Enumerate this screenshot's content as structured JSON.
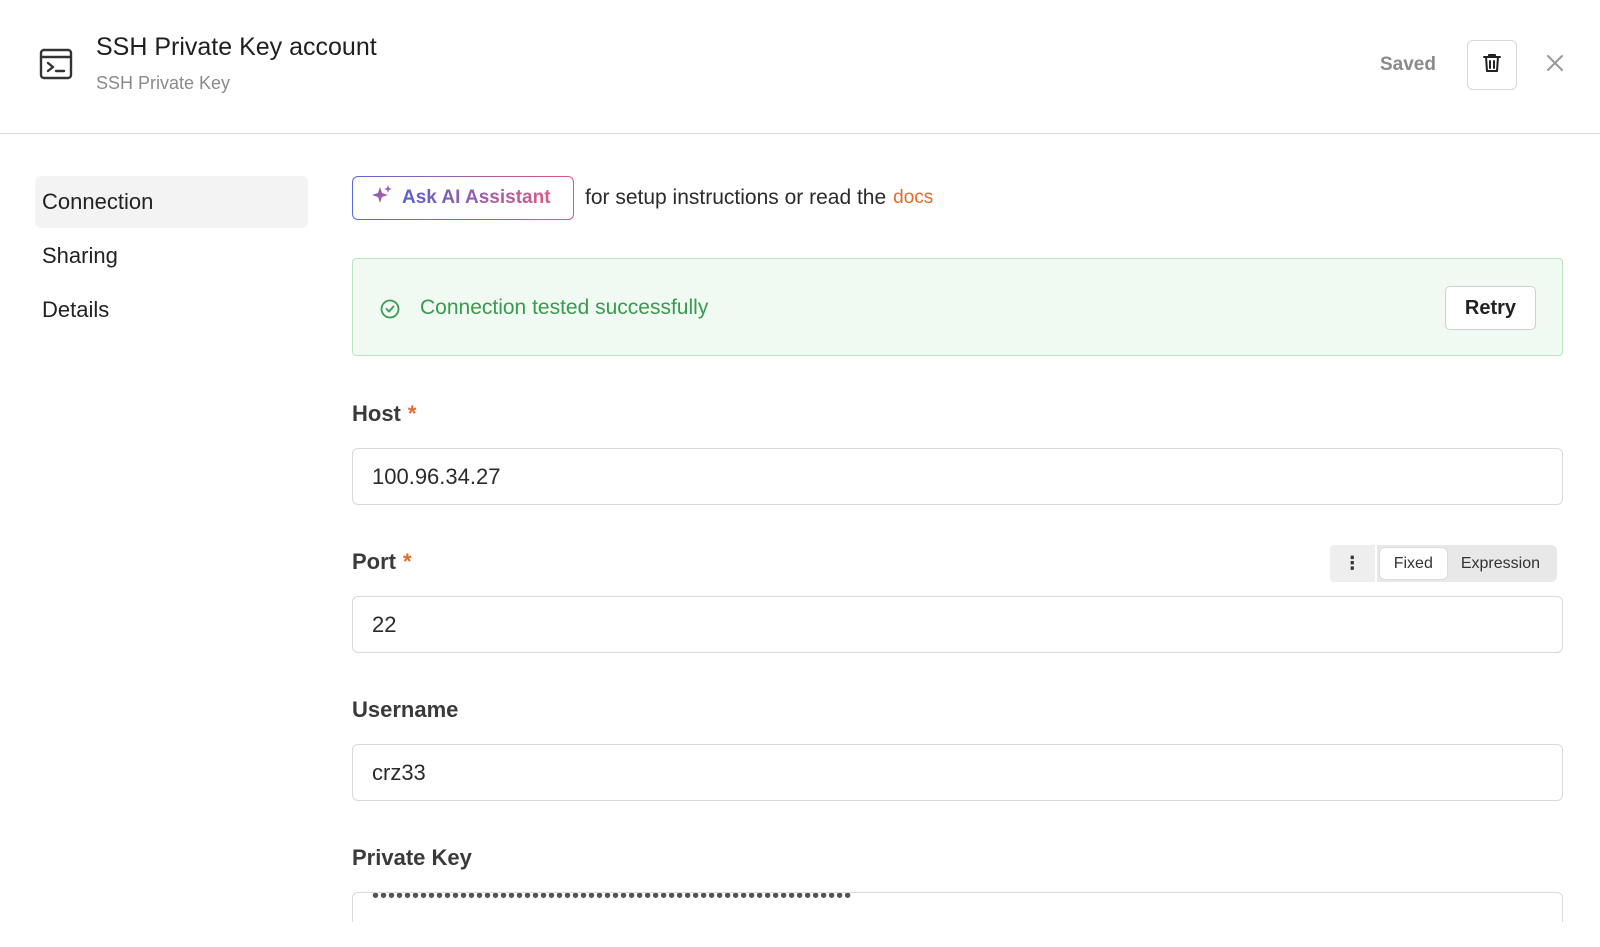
{
  "header": {
    "title": "SSH Private Key account",
    "subtitle": "SSH Private Key",
    "status": "Saved",
    "app_icon": "terminal-icon",
    "delete_icon": "trash-icon",
    "close_icon": "close-icon"
  },
  "sidebar": {
    "items": [
      {
        "label": "Connection",
        "active": true
      },
      {
        "label": "Sharing",
        "active": false
      },
      {
        "label": "Details",
        "active": false
      }
    ]
  },
  "assistant": {
    "button_label": "Ask AI Assistant",
    "text": "for setup instructions or read the",
    "docs_link": "docs",
    "icon": "sparkle-icon"
  },
  "status_banner": {
    "message": "Connection tested successfully",
    "retry_label": "Retry",
    "icon": "check-circle-icon"
  },
  "fields": {
    "host": {
      "label": "Host",
      "required_mark": "*",
      "value": "100.96.34.27"
    },
    "port": {
      "label": "Port",
      "required_mark": "*",
      "value": "22"
    },
    "username": {
      "label": "Username",
      "value": "crz33"
    },
    "private_key": {
      "label": "Private Key",
      "value": "••••••••••••••••••••••••••••••••••••••••••••••••••••••••••••"
    }
  },
  "port_mode": {
    "options": [
      "Fixed",
      "Expression"
    ],
    "selected": "Fixed",
    "menu_icon": "more-vertical-icon"
  },
  "colors": {
    "accent_orange": "#e46b2c",
    "success_green": "#3a9a4f",
    "success_bg": "#f0faf2",
    "ai_gradient_start": "#5a5fd4",
    "ai_gradient_end": "#d95b86"
  }
}
